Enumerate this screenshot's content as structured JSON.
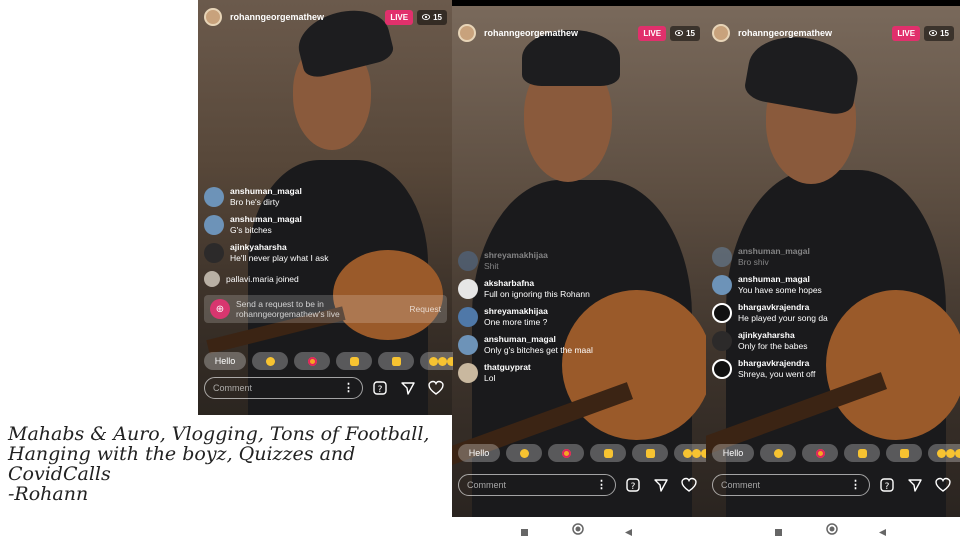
{
  "caption": {
    "lines": [
      "Mahabs & Auro, Vlogging, Tons of Football,",
      "Hanging with the boyz, Quizzes and",
      "CovidCalls",
      "-Rohann"
    ]
  },
  "common": {
    "username": "rohanngeorgemathew",
    "live_label": "LIVE",
    "viewer_count": "15",
    "reaction_hello": "Hello",
    "comment_placeholder": "Comment"
  },
  "panel1": {
    "comments": [
      {
        "user": "anshuman_magal",
        "text": "Bro he's dirty"
      },
      {
        "user": "anshuman_magal",
        "text": "G's bitches"
      },
      {
        "user": "ajinkyaharsha",
        "text": "He'll never play what I ask"
      }
    ],
    "joined_text": "pallavi.maria joined",
    "request": {
      "text_line1": "Send a request to be in",
      "text_line2": "rohanngeorgemathew's live",
      "button": "Request"
    }
  },
  "panel2": {
    "comments": [
      {
        "user": "shreyamakhijaa",
        "text": "Shit"
      },
      {
        "user": "aksharbafna",
        "text": "Full on ignoring this Rohann"
      },
      {
        "user": "shreyamakhijaa",
        "text": "One more time ?"
      },
      {
        "user": "anshuman_magal",
        "text": "Only g's bitches get the maal"
      },
      {
        "user": "thatguyprat",
        "text": "Lol"
      }
    ]
  },
  "panel3": {
    "comments": [
      {
        "user": "anshuman_magal",
        "text": "Bro shiv"
      },
      {
        "user": "anshuman_magal",
        "text": "You have some hopes"
      },
      {
        "user": "bhargavkrajendra",
        "text": "He played your song da"
      },
      {
        "user": "ajinkyaharsha",
        "text": "Only for the babes"
      },
      {
        "user": "bhargavkrajendra",
        "text": "Shreya, you went off"
      }
    ]
  },
  "colors": {
    "live": "#e1306c",
    "emoji_yellow": "#f7c331",
    "emoji_heart_eyes": "#f5a623",
    "heart": "#ff3b5c"
  },
  "icons": [
    "eye-icon",
    "more-dots-icon",
    "question-sticker-icon",
    "send-icon",
    "heart-icon",
    "nav-square-icon",
    "nav-circle-icon",
    "nav-back-icon"
  ]
}
